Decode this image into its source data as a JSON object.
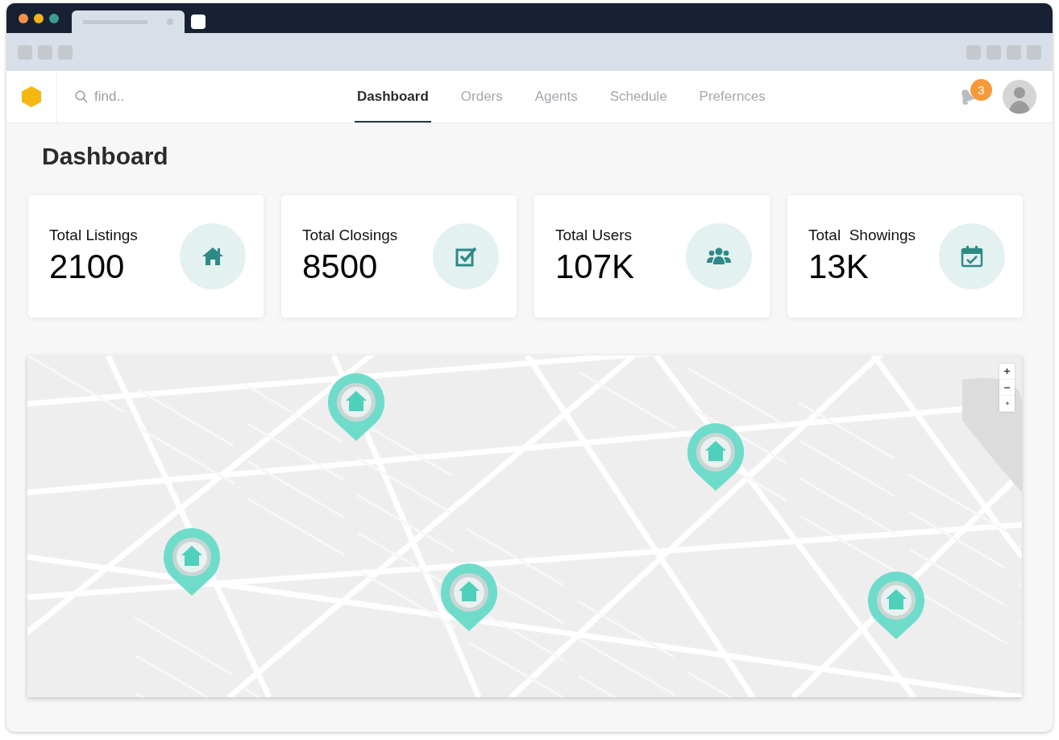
{
  "search": {
    "placeholder": "find.."
  },
  "nav": [
    {
      "label": "Dashboard",
      "selected": true
    },
    {
      "label": "Orders",
      "selected": false
    },
    {
      "label": "Agents",
      "selected": false
    },
    {
      "label": "Schedule",
      "selected": false
    },
    {
      "label": "Prefernces",
      "selected": false
    }
  ],
  "notifications": {
    "count": "3"
  },
  "page_title": "Dashboard",
  "stats": [
    {
      "label": "Total Listings",
      "value": "2100",
      "kind": "house"
    },
    {
      "label": "Total Closings",
      "value": "8500",
      "kind": "checkbox"
    },
    {
      "label": "Total Users",
      "value": "107K",
      "kind": "users"
    },
    {
      "label": "Total  Showings",
      "value": "13K",
      "kind": "calendar"
    }
  ]
}
